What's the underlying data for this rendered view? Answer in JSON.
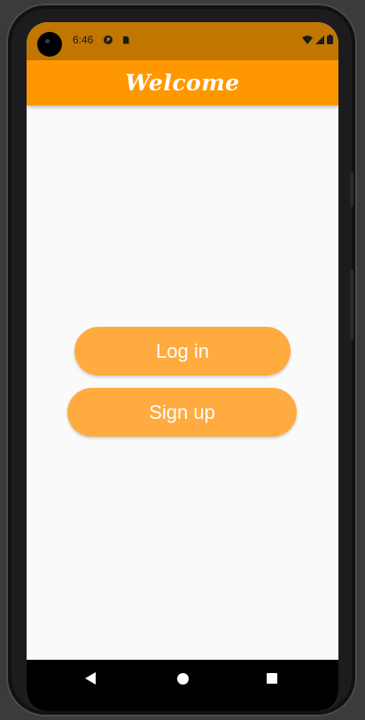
{
  "status_bar": {
    "time": "6:46",
    "icons": [
      "p-notification-icon",
      "sd-card-icon",
      "wifi-icon",
      "signal-icon",
      "battery-icon"
    ]
  },
  "app_bar": {
    "title": "Welcome",
    "background": "#ff9800"
  },
  "main": {
    "login_label": "Log in",
    "signup_label": "Sign up",
    "button_color": "#ffab40"
  },
  "nav_bar": {
    "icons": [
      "back-icon",
      "home-icon",
      "recents-icon"
    ]
  }
}
